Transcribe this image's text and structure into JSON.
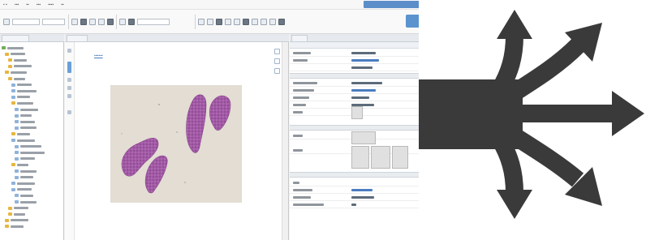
{
  "icons": {
    "workflow_arrows": "branching-arrows-icon"
  },
  "colors": {
    "arrow": "#3a3a3a",
    "tissue": "#a05aa3",
    "accent": "#5b8ec8"
  }
}
